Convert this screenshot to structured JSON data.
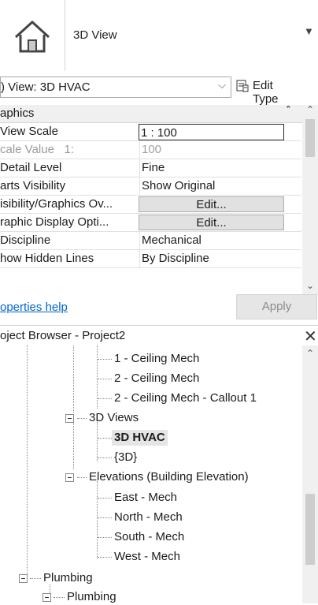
{
  "type_selector": {
    "name": "3D View",
    "thumbnail_icon": "house-icon",
    "dropdown_icon": "caret-down-icon"
  },
  "instance": {
    "label": ") View: 3D HVAC",
    "chevron_icon": "chevron-down-icon",
    "edit_type_label": "Edit Type",
    "edit_type_icon": "edit-type-icon"
  },
  "properties": {
    "group": "aphics",
    "collapse_icon": "double-chevron-up-icon",
    "rows": [
      {
        "name": "View Scale",
        "value": "1 : 100"
      },
      {
        "name": "cale Value",
        "name_suffix": "1:",
        "value": "100"
      },
      {
        "name": "Detail Level",
        "value": "Fine"
      },
      {
        "name": "arts Visibility",
        "value": "Show Original"
      },
      {
        "name": "isibility/Graphics Ov...",
        "value": "Edit..."
      },
      {
        "name": "raphic Display Opti...",
        "value": "Edit..."
      },
      {
        "name": "Discipline",
        "value": "Mechanical"
      },
      {
        "name": "how Hidden Lines",
        "value": "By Discipline"
      }
    ],
    "help_link": "operties help",
    "apply_label": "Apply"
  },
  "project_browser": {
    "title": "oject Browser - Project2",
    "close_icon": "close-icon",
    "tree": {
      "ceiling_1": "1 - Ceiling Mech",
      "ceiling_2": "2 - Ceiling Mech",
      "ceiling_callout": "2 - Ceiling Mech - Callout 1",
      "views_3d": "3D Views",
      "view_3d_hvac": "3D HVAC",
      "view_3d": "{3D}",
      "elevations": "Elevations (Building Elevation)",
      "east": "East - Mech",
      "north": "North - Mech",
      "south": "South - Mech",
      "west": "West - Mech",
      "plumbing": "Plumbing",
      "plumbing_sub": "Plumbing"
    }
  },
  "colors": {
    "link": "#0066cc",
    "panel_gray": "#f0f0f0",
    "selection": "#e5e5e5"
  }
}
